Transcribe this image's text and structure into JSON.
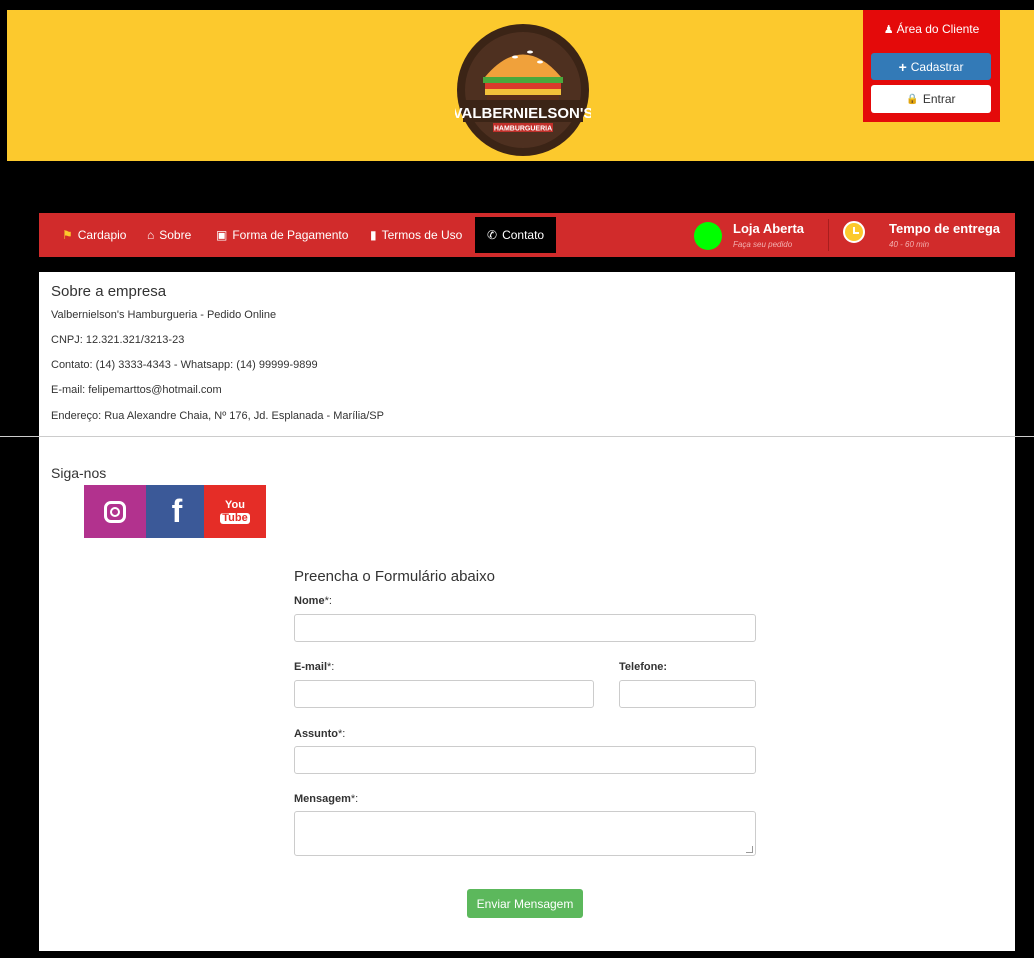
{
  "header": {
    "logo_text_main": "VALBERNIELSON'S",
    "logo_text_sub": "HAMBURGUERIA",
    "cliente": {
      "title": "Área do Cliente",
      "cadastrar_label": "Cadastrar",
      "entrar_label": "Entrar"
    }
  },
  "nav": {
    "items": [
      {
        "label": "Cardapio",
        "icon": "cutlery-icon"
      },
      {
        "label": "Sobre",
        "icon": "home-icon"
      },
      {
        "label": "Forma de Pagamento",
        "icon": "money-icon"
      },
      {
        "label": "Termos de Uso",
        "icon": "file-icon"
      },
      {
        "label": "Contato",
        "icon": "phone-icon"
      }
    ],
    "status": {
      "title": "Loja Aberta",
      "subtitle": "Faça seu pedido"
    },
    "delivery": {
      "title": "Tempo de entrega",
      "subtitle": "40 - 60 min"
    }
  },
  "about": {
    "title": "Sobre a empresa",
    "lines": [
      "Valbernielson's Hamburgueria - Pedido Online",
      "CNPJ: 12.321.321/3213-23",
      "Contato: (14) 3333-4343 - Whatsapp: (14) 99999-9899",
      "E-mail: felipemarttos@hotmail.com",
      "Endereço: Rua Alexandre Chaia, Nº 176, Jd. Esplanada - Marília/SP"
    ]
  },
  "social": {
    "title": "Siga-nos",
    "youtube_you": "You",
    "youtube_tube": "Tube",
    "facebook_glyph": "f"
  },
  "form": {
    "title": "Preencha o Formulário abaixo",
    "nome_label": "Nome",
    "email_label": "E-mail",
    "telefone_label": "Telefone:",
    "assunto_label": "Assunto",
    "mensagem_label": "Mensagem",
    "required_mark": "*:",
    "submit_label": "Enviar Mensagem"
  },
  "colors": {
    "header_bg": "#fcc92d",
    "nav_bg": "#d12b2b",
    "cliente_bg": "#e40a0a",
    "primary": "#337ab7",
    "success": "#5cb85c"
  }
}
